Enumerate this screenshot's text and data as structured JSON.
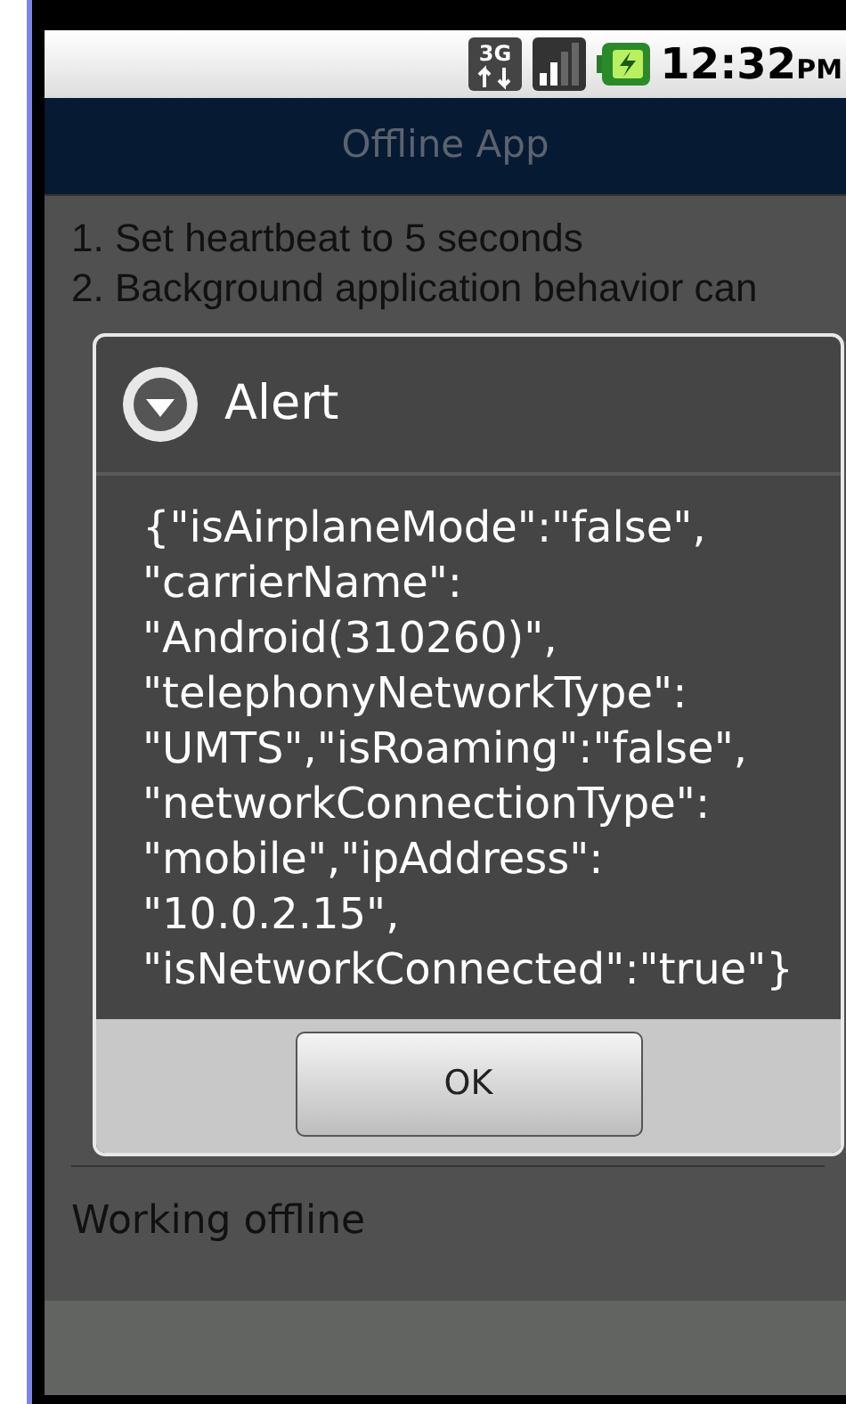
{
  "status_bar": {
    "network_type": "3G",
    "time": "12:32",
    "time_suffix": "PM"
  },
  "header": {
    "title": "Offline App"
  },
  "steps": [
    "1. Set heartbeat to 5 seconds",
    "2. Background application behavior can"
  ],
  "status_text": "Working offline",
  "dialog": {
    "title": "Alert",
    "message_lines": [
      "{\"isAirplaneMode\":\"false\",",
      "\"carrierName\":",
      "\"Android(310260)\",",
      "\"telephonyNetworkType\":",
      "\"UMTS\",\"isRoaming\":\"false\",",
      "\"networkConnectionType\":",
      "\"mobile\",\"ipAddress\":",
      "\"10.0.2.15\",",
      "\"isNetworkConnected\":\"true\"}"
    ],
    "buttons": [
      "OK"
    ]
  }
}
